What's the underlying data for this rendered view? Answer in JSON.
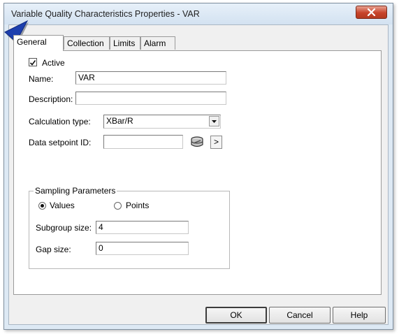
{
  "window": {
    "title": "Variable Quality Characteristics Properties - VAR"
  },
  "tabs": [
    {
      "label": "General"
    },
    {
      "label": "Collection"
    },
    {
      "label": "Limits"
    },
    {
      "label": "Alarm"
    }
  ],
  "general": {
    "active_label": "Active",
    "active_checked": true,
    "name_label": "Name:",
    "name_value": "VAR",
    "description_label": "Description:",
    "description_value": "",
    "calc_type_label": "Calculation type:",
    "calc_type_value": "XBar/R",
    "setpoint_label": "Data setpoint ID:",
    "setpoint_value": "",
    "browse_icon": "data-browse-icon",
    "more_label": ">"
  },
  "sampling": {
    "title": "Sampling Parameters",
    "values_label": "Values",
    "points_label": "Points",
    "selected": "Values",
    "subgroup_label": "Subgroup size:",
    "subgroup_value": "4",
    "gap_label": "Gap size:",
    "gap_value": "0"
  },
  "buttons": {
    "ok": "OK",
    "cancel": "Cancel",
    "help": "Help"
  }
}
